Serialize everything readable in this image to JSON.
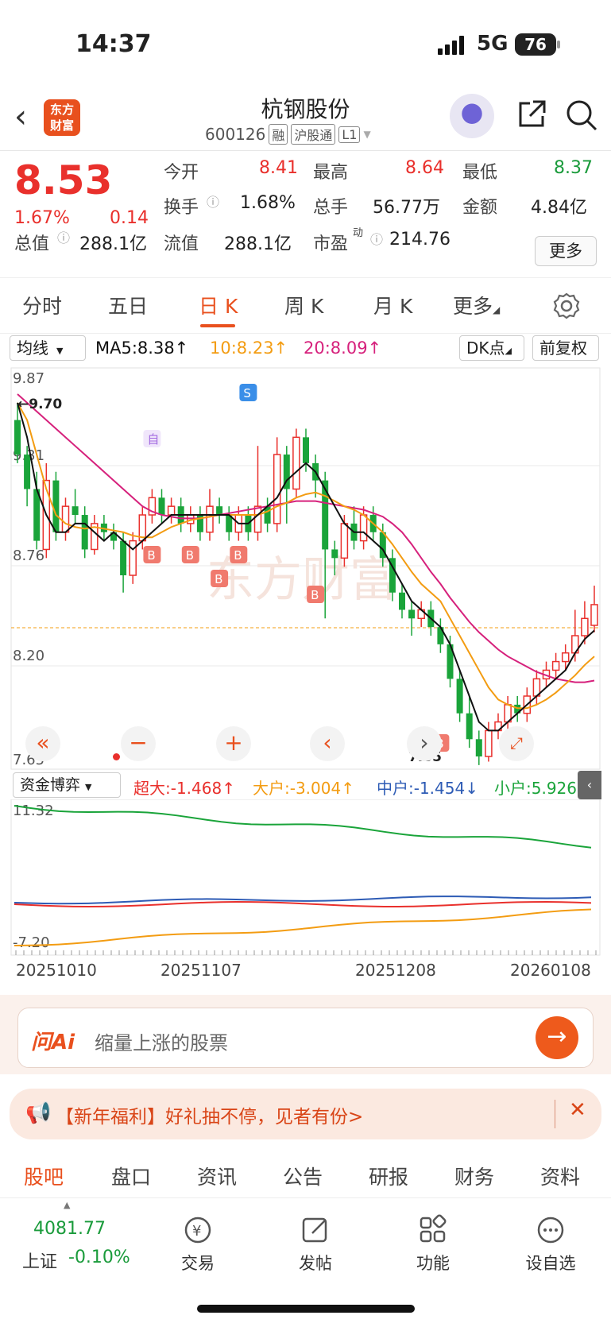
{
  "status": {
    "time": "14:37",
    "network": "5G",
    "battery": "76"
  },
  "header": {
    "logo": "东方\n财富",
    "title": "杭钢股份",
    "code": "600126",
    "tags": [
      "融",
      "沪股通",
      "L1"
    ]
  },
  "quote": {
    "price": "8.53",
    "pct": "1.67%",
    "change": "0.14",
    "fields": {
      "open_label": "今开",
      "open": "8.41",
      "high_label": "最高",
      "high": "8.64",
      "low_label": "最低",
      "low": "8.37",
      "turnover_label": "换手",
      "turnover": "1.68%",
      "volume_label": "总手",
      "volume": "56.77万",
      "amount_label": "金额",
      "amount": "4.84亿",
      "mktcap_label": "总值",
      "mktcap": "288.1亿",
      "float_label": "流值",
      "float": "288.1亿",
      "pe_label": "市盈",
      "pe_sup": "动",
      "pe": "214.76"
    },
    "more": "更多"
  },
  "tabs": [
    "分时",
    "五日",
    "日 K",
    "周 K",
    "月 K",
    "更多"
  ],
  "ma": {
    "select": "均线",
    "ma5": "MA5:8.38↑",
    "ma10": "10:8.23↑",
    "ma20": "20:8.09↑",
    "dk": "DK点",
    "adjust": "前复权",
    "colors": {
      "ma5": "#111111",
      "ma10": "#f39c12",
      "ma20": "#d6217c"
    }
  },
  "chart_data": {
    "type": "candlestick",
    "ylim": [
      7.65,
      9.87
    ],
    "y_ticks": [
      "9.87",
      "9.31",
      "8.76",
      "8.20",
      "7.65"
    ],
    "max_label": "9.70",
    "min_label": "7.65",
    "markers": [
      "自",
      "S",
      "B",
      "B",
      "B",
      "B",
      "B",
      "B"
    ],
    "candles": [
      [
        9.6,
        9.4,
        9.7,
        9.35
      ],
      [
        9.4,
        9.2,
        9.45,
        9.1
      ],
      [
        9.2,
        8.9,
        9.3,
        8.85
      ],
      [
        8.85,
        9.25,
        9.35,
        8.8
      ],
      [
        9.25,
        8.95,
        9.3,
        8.9
      ],
      [
        8.95,
        9.1,
        9.15,
        8.9
      ],
      [
        9.1,
        9.05,
        9.2,
        9.0
      ],
      [
        9.05,
        8.85,
        9.1,
        8.8
      ],
      [
        8.85,
        9.0,
        9.05,
        8.82
      ],
      [
        9.0,
        8.95,
        9.05,
        8.9
      ],
      [
        8.95,
        8.9,
        9.0,
        8.85
      ],
      [
        8.9,
        8.7,
        8.95,
        8.6
      ],
      [
        8.7,
        8.9,
        8.95,
        8.65
      ],
      [
        8.9,
        9.05,
        9.1,
        8.85
      ],
      [
        9.05,
        9.15,
        9.2,
        9.0
      ],
      [
        9.15,
        9.05,
        9.2,
        9.0
      ],
      [
        9.05,
        9.1,
        9.15,
        9.0
      ],
      [
        9.1,
        9.0,
        9.15,
        8.95
      ],
      [
        9.0,
        9.05,
        9.1,
        8.95
      ],
      [
        9.05,
        8.95,
        9.1,
        8.9
      ],
      [
        8.95,
        9.1,
        9.2,
        8.9
      ],
      [
        9.1,
        9.05,
        9.15,
        9.0
      ],
      [
        9.05,
        8.95,
        9.1,
        8.9
      ],
      [
        8.95,
        9.05,
        9.1,
        8.9
      ],
      [
        9.05,
        8.95,
        9.1,
        8.9
      ],
      [
        8.95,
        9.1,
        9.45,
        8.9
      ],
      [
        9.1,
        9.0,
        9.15,
        8.95
      ],
      [
        9.0,
        9.4,
        9.5,
        8.95
      ],
      [
        9.4,
        9.2,
        9.45,
        9.0
      ],
      [
        9.2,
        9.5,
        9.55,
        9.15
      ],
      [
        9.5,
        9.35,
        9.55,
        9.3
      ],
      [
        9.35,
        9.25,
        9.4,
        9.15
      ],
      [
        9.25,
        8.85,
        9.3,
        8.45
      ],
      [
        8.85,
        8.8,
        8.9,
        8.7
      ],
      [
        8.8,
        9.0,
        9.05,
        8.75
      ],
      [
        9.0,
        8.9,
        9.1,
        8.85
      ],
      [
        8.9,
        9.05,
        9.1,
        8.85
      ],
      [
        9.05,
        8.95,
        9.1,
        8.9
      ],
      [
        8.95,
        8.8,
        9.0,
        8.75
      ],
      [
        8.8,
        8.6,
        8.85,
        8.55
      ],
      [
        8.6,
        8.5,
        8.65,
        8.45
      ],
      [
        8.5,
        8.45,
        8.55,
        8.35
      ],
      [
        8.45,
        8.5,
        8.55,
        8.4
      ],
      [
        8.5,
        8.4,
        8.55,
        8.35
      ],
      [
        8.4,
        8.3,
        8.45,
        8.25
      ],
      [
        8.3,
        8.1,
        8.35,
        8.05
      ],
      [
        8.1,
        7.9,
        8.15,
        7.85
      ],
      [
        7.9,
        7.75,
        8.0,
        7.7
      ],
      [
        7.75,
        7.65,
        7.8,
        7.6
      ],
      [
        7.65,
        7.8,
        7.85,
        7.62
      ],
      [
        7.8,
        7.85,
        7.9,
        7.75
      ],
      [
        7.85,
        7.95,
        8.0,
        7.8
      ],
      [
        7.95,
        7.9,
        8.0,
        7.85
      ],
      [
        7.9,
        8.0,
        8.05,
        7.85
      ],
      [
        8.0,
        8.1,
        8.15,
        7.95
      ],
      [
        8.1,
        8.15,
        8.2,
        8.05
      ],
      [
        8.15,
        8.2,
        8.25,
        8.1
      ],
      [
        8.2,
        8.25,
        8.3,
        8.15
      ],
      [
        8.25,
        8.35,
        8.5,
        8.2
      ],
      [
        8.35,
        8.45,
        8.55,
        8.3
      ],
      [
        8.41,
        8.53,
        8.64,
        8.37
      ]
    ],
    "ma5": [
      9.7,
      9.5,
      9.2,
      9.05,
      8.95,
      8.95,
      9.0,
      9.0,
      8.95,
      8.9,
      8.95,
      8.9,
      8.85,
      8.9,
      8.95,
      9.0,
      9.05,
      9.05,
      9.05,
      9.05,
      9.05,
      9.05,
      9.05,
      9.0,
      9.0,
      9.05,
      9.1,
      9.15,
      9.25,
      9.3,
      9.35,
      9.3,
      9.2,
      9.1,
      9.0,
      8.95,
      8.95,
      8.9,
      8.85,
      8.75,
      8.65,
      8.55,
      8.5,
      8.45,
      8.4,
      8.3,
      8.15,
      8.0,
      7.85,
      7.8,
      7.8,
      7.85,
      7.9,
      7.95,
      8.0,
      8.05,
      8.1,
      8.15,
      8.25,
      8.33,
      8.38
    ],
    "ma10": [
      9.7,
      9.6,
      9.4,
      9.2,
      9.05,
      9.0,
      8.98,
      8.97,
      8.98,
      8.97,
      8.96,
      8.95,
      8.93,
      8.92,
      8.92,
      8.95,
      8.98,
      9.0,
      9.02,
      9.03,
      9.04,
      9.05,
      9.05,
      9.05,
      9.05,
      9.05,
      9.07,
      9.1,
      9.12,
      9.15,
      9.17,
      9.18,
      9.16,
      9.13,
      9.1,
      9.08,
      9.05,
      9.0,
      8.95,
      8.88,
      8.8,
      8.72,
      8.65,
      8.6,
      8.55,
      8.45,
      8.35,
      8.25,
      8.15,
      8.05,
      7.98,
      7.95,
      7.93,
      7.93,
      7.95,
      7.98,
      8.02,
      8.07,
      8.12,
      8.18,
      8.23
    ],
    "ma20": [
      9.75,
      9.7,
      9.65,
      9.6,
      9.55,
      9.5,
      9.45,
      9.4,
      9.35,
      9.3,
      9.25,
      9.2,
      9.15,
      9.1,
      9.07,
      9.05,
      9.04,
      9.03,
      9.03,
      9.03,
      9.04,
      9.05,
      9.06,
      9.07,
      9.08,
      9.09,
      9.1,
      9.11,
      9.12,
      9.13,
      9.13,
      9.13,
      9.12,
      9.11,
      9.1,
      9.09,
      9.08,
      9.06,
      9.04,
      9.0,
      8.95,
      8.88,
      8.8,
      8.72,
      8.65,
      8.57,
      8.5,
      8.43,
      8.37,
      8.32,
      8.27,
      8.23,
      8.2,
      8.17,
      8.14,
      8.12,
      8.1,
      8.09,
      8.08,
      8.08,
      8.09
    ]
  },
  "fund": {
    "select": "资金博弈",
    "super": "超大:-1.468↑",
    "big": "大户:-3.004↑",
    "mid": "中户:-1.454↓",
    "small": "小户:5.926",
    "ymax": "11.32",
    "ymin": "-7.20",
    "colors": {
      "super": "#e9302c",
      "big": "#f39c12",
      "mid": "#2d5bb5",
      "small": "#1aa43a"
    }
  },
  "dates": [
    "20251010",
    "20251107",
    "20251208",
    "20260108"
  ],
  "ai": {
    "logo": "问Ai",
    "placeholder": "缩量上涨的股票"
  },
  "promo": {
    "text": "【新年福利】好礼抽不停，见者有份>"
  },
  "bottom_tabs": [
    "股吧",
    "盘口",
    "资讯",
    "公告",
    "研报",
    "财务",
    "资料"
  ],
  "dock": {
    "index_value": "4081.77",
    "index_name": "上证",
    "index_change": "-0.10%",
    "items": [
      "交易",
      "发帖",
      "功能",
      "设自选"
    ]
  }
}
